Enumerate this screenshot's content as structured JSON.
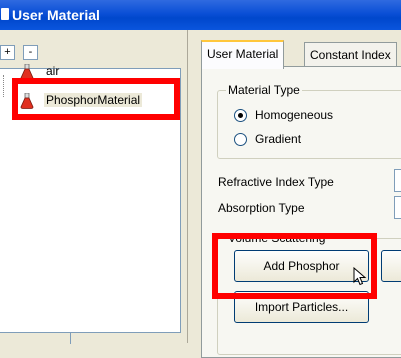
{
  "window": {
    "title": "User Material"
  },
  "tree_toolbar": {
    "expand": "+",
    "collapse": "-"
  },
  "tree": {
    "items": [
      {
        "label": "air",
        "selected": false
      },
      {
        "label": "PhosphorMaterial",
        "selected": true
      }
    ]
  },
  "tabs": [
    {
      "label": "User Material",
      "active": true
    },
    {
      "label": "Constant Index",
      "active": false
    }
  ],
  "material_type": {
    "title": "Material Type",
    "options": [
      {
        "label": "Homogeneous",
        "checked": true
      },
      {
        "label": "Gradient",
        "checked": false
      }
    ]
  },
  "fields": {
    "refractive_index_type": "Refractive Index Type",
    "absorption_type": "Absorption Type"
  },
  "volume_scattering": {
    "title": "Volume Scattering",
    "add_phosphor": "Add Phosphor",
    "import_particles": "Import Particles..."
  },
  "colors": {
    "highlight": "#ff0000",
    "title_bar": "#0a4fd6"
  }
}
